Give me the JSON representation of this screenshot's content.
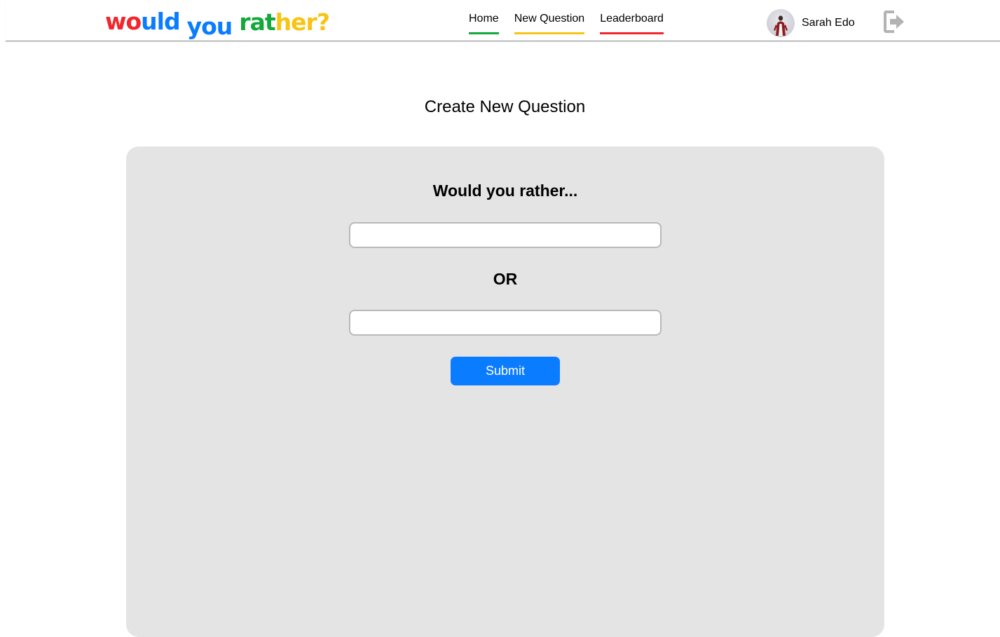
{
  "header": {
    "logo": {
      "letters": [
        {
          "ch": "w",
          "color": "#f2262c",
          "word": 1
        },
        {
          "ch": "o",
          "color": "#f2262c",
          "word": 1
        },
        {
          "ch": "u",
          "color": "#0a7cff",
          "word": 1
        },
        {
          "ch": "l",
          "color": "#0a7cff",
          "word": 1
        },
        {
          "ch": "d",
          "color": "#0a7cff",
          "word": 1
        },
        {
          "ch": "y",
          "color": "#0a7cff",
          "word": 2
        },
        {
          "ch": "o",
          "color": "#0a7cff",
          "word": 2
        },
        {
          "ch": "u",
          "color": "#0a7cff",
          "word": 2
        },
        {
          "ch": "r",
          "color": "#13a83a",
          "word": 3
        },
        {
          "ch": "a",
          "color": "#13a83a",
          "word": 3
        },
        {
          "ch": "t",
          "color": "#13a83a",
          "word": 3
        },
        {
          "ch": "h",
          "color": "#f8c414",
          "word": 3
        },
        {
          "ch": "e",
          "color": "#f8c414",
          "word": 3
        },
        {
          "ch": "r",
          "color": "#f8c414",
          "word": 3
        },
        {
          "ch": "?",
          "color": "#f8c414",
          "word": 3
        }
      ]
    },
    "nav": [
      {
        "label": "Home",
        "accent": "#13a83a"
      },
      {
        "label": "New Question",
        "accent": "#f8c414"
      },
      {
        "label": "Leaderboard",
        "accent": "#f2262c"
      }
    ],
    "user": {
      "name": "Sarah Edo"
    },
    "logout_icon": "logout-icon"
  },
  "main": {
    "title": "Create New Question",
    "form": {
      "heading": "Would you rather...",
      "option_one": {
        "value": "",
        "placeholder": ""
      },
      "or_label": "OR",
      "option_two": {
        "value": "",
        "placeholder": ""
      },
      "submit_label": "Submit"
    }
  },
  "colors": {
    "submit": "#0a7cff",
    "card_bg": "#e4e4e4"
  }
}
